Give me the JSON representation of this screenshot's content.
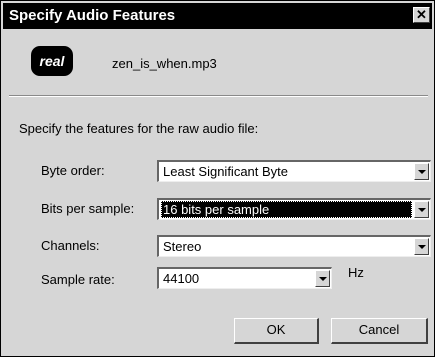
{
  "window": {
    "title": "Specify Audio Features",
    "close_glyph": "✕"
  },
  "header": {
    "logo_text": "real",
    "filename": "zen_is_when.mp3"
  },
  "instructions": "Specify the features for the raw audio file:",
  "fields": {
    "byte_order": {
      "label": "Byte order:",
      "value": "Least Significant Byte"
    },
    "bits_per_sample": {
      "label": "Bits per sample:",
      "value": "16 bits per sample"
    },
    "channels": {
      "label": "Channels:",
      "value": "Stereo"
    },
    "sample_rate": {
      "label": "Sample rate:",
      "value": "44100",
      "unit": "Hz"
    }
  },
  "buttons": {
    "ok": "OK",
    "cancel": "Cancel"
  },
  "colors": {
    "title_bar": "#000000",
    "dialog_bg": "#d6d6d6",
    "selection": "#000000"
  }
}
